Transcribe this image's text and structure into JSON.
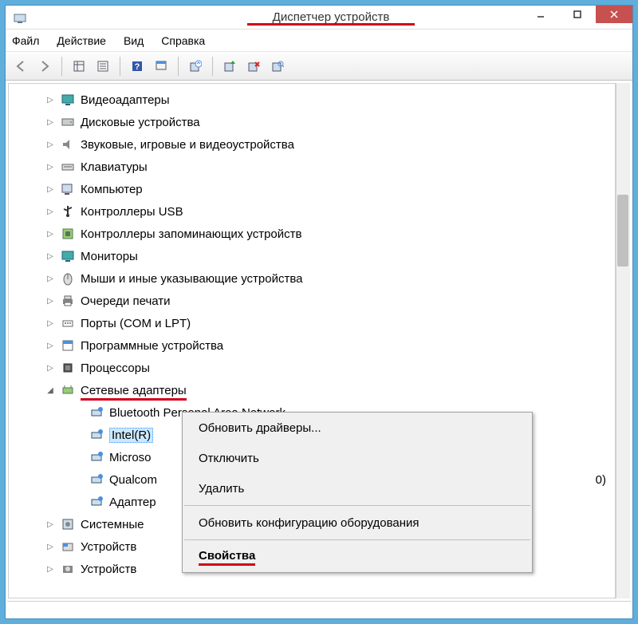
{
  "titlebar": {
    "title": "Диспетчер устройств"
  },
  "menu": [
    "Файл",
    "Действие",
    "Вид",
    "Справка"
  ],
  "tree": {
    "items": [
      {
        "label": "Видеоадаптеры",
        "icon": "monitor"
      },
      {
        "label": "Дисковые устройства",
        "icon": "disk"
      },
      {
        "label": "Звуковые, игровые и видеоустройства",
        "icon": "speaker"
      },
      {
        "label": "Клавиатуры",
        "icon": "keyboard"
      },
      {
        "label": "Компьютер",
        "icon": "computer"
      },
      {
        "label": "Контроллеры USB",
        "icon": "usb"
      },
      {
        "label": "Контроллеры запоминающих устройств",
        "icon": "storage"
      },
      {
        "label": "Мониторы",
        "icon": "monitor"
      },
      {
        "label": "Мыши и иные указывающие устройства",
        "icon": "mouse"
      },
      {
        "label": "Очереди печати",
        "icon": "printer"
      },
      {
        "label": "Порты (COM и LPT)",
        "icon": "port"
      },
      {
        "label": "Программные устройства",
        "icon": "software"
      },
      {
        "label": "Процессоры",
        "icon": "cpu"
      },
      {
        "label": "Сетевые адаптеры",
        "icon": "network",
        "expanded": true,
        "annotated": true,
        "children": [
          {
            "label": "Bluetooth Personal Area Network",
            "icon": "netadapter"
          },
          {
            "label": "Intel(R)",
            "icon": "netadapter",
            "selected": true
          },
          {
            "label": "Microso",
            "icon": "netadapter"
          },
          {
            "label": "Qualcom",
            "icon": "netadapter",
            "trail": "0)"
          },
          {
            "label": "Адаптер",
            "icon": "netadapter"
          }
        ]
      },
      {
        "label": "Системные",
        "icon": "system"
      },
      {
        "label": "Устройств",
        "icon": "hid"
      },
      {
        "label": "Устройств",
        "icon": "imaging"
      }
    ]
  },
  "context_menu": {
    "items": [
      {
        "label": "Обновить драйверы..."
      },
      {
        "label": "Отключить"
      },
      {
        "label": "Удалить"
      },
      {
        "sep": true
      },
      {
        "label": "Обновить конфигурацию оборудования"
      },
      {
        "sep": true
      },
      {
        "label": "Свойства",
        "bold": true,
        "annotated": true
      }
    ]
  }
}
